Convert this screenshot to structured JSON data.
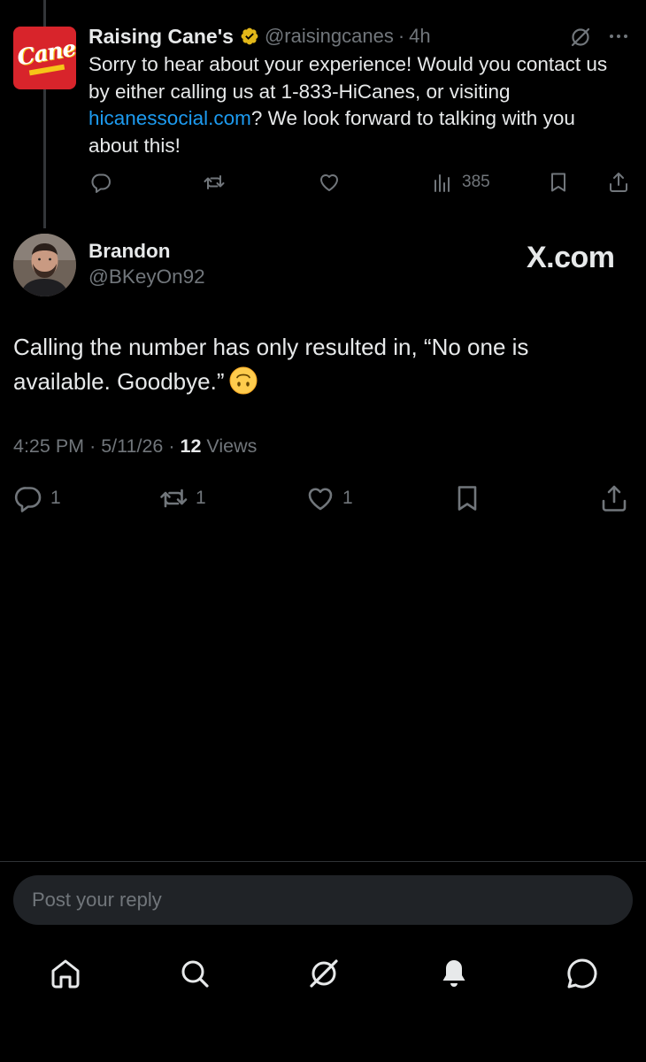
{
  "parent_tweet": {
    "name": "Raising Cane's",
    "handle": "@raisingcanes",
    "separator": "·",
    "time": "4h",
    "body_prefix": "Sorry to hear about your experience! Would you contact us by either calling us at 1-833-HiCanes, or visiting ",
    "link": "hicanessocial.com",
    "body_suffix": "? We look forward to talking with you about this!",
    "views": "385",
    "avatar_logo_text": "Canes",
    "icons": [
      "reply-icon",
      "retweet-icon",
      "like-icon",
      "views-icon",
      "bookmark-icon",
      "share-icon",
      "grok-icon",
      "more-icon",
      "verified-badge-icon"
    ]
  },
  "main_tweet": {
    "name": "Brandon",
    "handle": "@BKeyOn92",
    "watermark": "X.com",
    "body": "Calling the number has only resulted in, “No one is available. Goodbye.”",
    "emoji": "upside-down-face",
    "time": "4:25 PM",
    "separator": "·",
    "date": "5/11/26",
    "views_count": "12",
    "views_label": "Views",
    "replies": "1",
    "retweets": "1",
    "likes": "1"
  },
  "reply": {
    "placeholder": "Post your reply"
  },
  "nav": [
    "home-icon",
    "search-icon",
    "grok-icon",
    "notifications-icon",
    "messages-icon"
  ],
  "colors": {
    "background": "#000000",
    "text": "#e7e9ea",
    "muted": "#71767b",
    "link": "#1d9bf0",
    "brand_red": "#d8242b",
    "verified_gold": "#e2b719"
  }
}
